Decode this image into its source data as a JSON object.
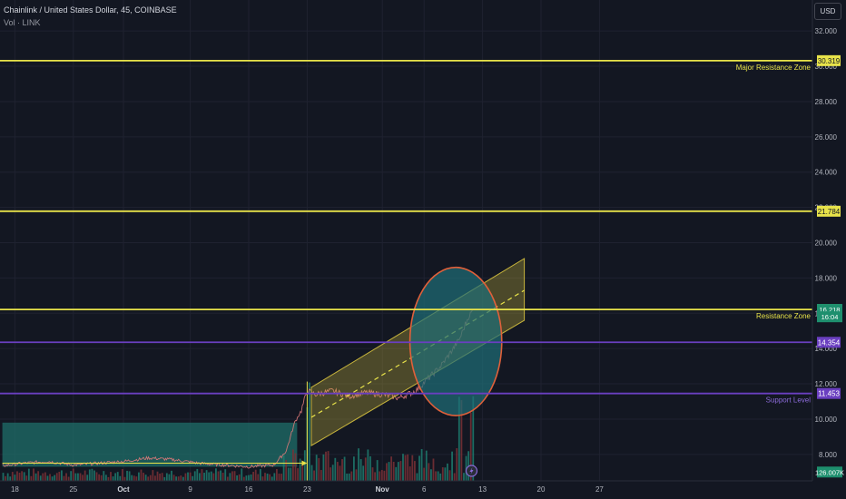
{
  "header": {
    "symbol_line": "Chainlink / United States Dollar, 45, COINBASE",
    "volume_line": "Vol · LINK"
  },
  "currency_button": "USD",
  "colors": {
    "background": "#131722",
    "grid": "#1f2230",
    "yellow": "#e8e34a",
    "purple": "#6a3fc0",
    "channel_fill": "#c7b43c",
    "circle_fill": "#1f6f78",
    "circle_stroke": "#e0603a",
    "teal_box": "#1f6f6a",
    "vol_up": "#1e7b6e",
    "vol_down": "#7a3035"
  },
  "chart_data": {
    "type": "line",
    "title": "Chainlink / United States Dollar, 45, COINBASE",
    "xlabel": "",
    "ylabel": "",
    "ylim": [
      6.5,
      33.5
    ],
    "y_ticks": [
      "8.000",
      "10.000",
      "12.000",
      "14.000",
      "16.000",
      "18.000",
      "20.000",
      "22.000",
      "24.000",
      "26.000",
      "28.000",
      "30.000",
      "32.000"
    ],
    "x_ticks": [
      {
        "label": "18",
        "day": -13
      },
      {
        "label": "25",
        "day": -6
      },
      {
        "label": "Oct",
        "day": 0
      },
      {
        "label": "9",
        "day": 8
      },
      {
        "label": "16",
        "day": 15
      },
      {
        "label": "23",
        "day": 22
      },
      {
        "label": "Nov",
        "day": 31
      },
      {
        "label": "6",
        "day": 36
      },
      {
        "label": "13",
        "day": 43
      },
      {
        "label": "20",
        "day": 50
      },
      {
        "label": "27",
        "day": 57
      }
    ],
    "price_path": [
      {
        "day": -14.5,
        "price": 7.35
      },
      {
        "day": -12,
        "price": 7.5
      },
      {
        "day": -9,
        "price": 7.6
      },
      {
        "day": -6,
        "price": 7.4
      },
      {
        "day": -3,
        "price": 7.5
      },
      {
        "day": 0,
        "price": 7.6
      },
      {
        "day": 3,
        "price": 7.8
      },
      {
        "day": 6,
        "price": 7.7
      },
      {
        "day": 9,
        "price": 7.5
      },
      {
        "day": 12,
        "price": 7.4
      },
      {
        "day": 15,
        "price": 7.3
      },
      {
        "day": 18,
        "price": 7.4
      },
      {
        "day": 19.5,
        "price": 8.2
      },
      {
        "day": 20.5,
        "price": 9.8
      },
      {
        "day": 21.3,
        "price": 10.5
      },
      {
        "day": 22.0,
        "price": 11.6
      },
      {
        "day": 23.0,
        "price": 11.4
      },
      {
        "day": 25,
        "price": 11.6
      },
      {
        "day": 27,
        "price": 11.3
      },
      {
        "day": 29,
        "price": 11.5
      },
      {
        "day": 31,
        "price": 11.4
      },
      {
        "day": 33,
        "price": 11.2
      },
      {
        "day": 35,
        "price": 11.6
      },
      {
        "day": 36.5,
        "price": 12.3
      },
      {
        "day": 38,
        "price": 13.0
      },
      {
        "day": 39.5,
        "price": 14.0
      },
      {
        "day": 40.3,
        "price": 14.6
      },
      {
        "day": 40.8,
        "price": 15.2
      },
      {
        "day": 41.3,
        "price": 15.8
      },
      {
        "day": 41.9,
        "price": 16.2
      }
    ],
    "volume": {
      "baseline_day_start": -14.5,
      "spike_days": [
        22.0,
        40.2,
        41.6
      ],
      "note_label": "126.007K",
      "value_scale_note": "relative"
    },
    "horizontal_levels": [
      {
        "price": 30.319,
        "label": "30.319",
        "color": "yellow",
        "annotation": "Major Resistance Zone"
      },
      {
        "price": 21.784,
        "label": "21.784",
        "color": "yellow",
        "annotation": ""
      },
      {
        "price": 16.213,
        "label": "16.213",
        "color": "yellow",
        "annotation": "Resistance Zone"
      },
      {
        "price": 14.354,
        "label": "14.354",
        "color": "purple",
        "annotation": ""
      },
      {
        "price": 11.453,
        "label": "11.453",
        "color": "purple",
        "annotation": "Support Level"
      }
    ],
    "axis_badges": [
      {
        "price": 16.218,
        "text": "16.218",
        "color": "green"
      },
      {
        "price": 15.8,
        "text": "16:04",
        "color": "green"
      },
      {
        "price": 7.0,
        "text": "126.007K",
        "color": "green"
      }
    ],
    "channel": {
      "start_day": 22.5,
      "end_day": 48.0,
      "start_low": 8.5,
      "start_high": 11.8,
      "end_low": 15.6,
      "end_high": 19.1,
      "mid_start": 10.1,
      "mid_end": 17.3
    },
    "circle": {
      "center_day": 39.8,
      "center_price": 14.4,
      "radius_days": 5.5,
      "radius_price": 4.2
    },
    "teal_box": {
      "start_day": -14.5,
      "end_day": 20.8,
      "low_price": 7.3,
      "high_price": 9.8
    },
    "arrow": {
      "start_day": -14.5,
      "end_day": 22.0,
      "price": 7.5
    }
  }
}
